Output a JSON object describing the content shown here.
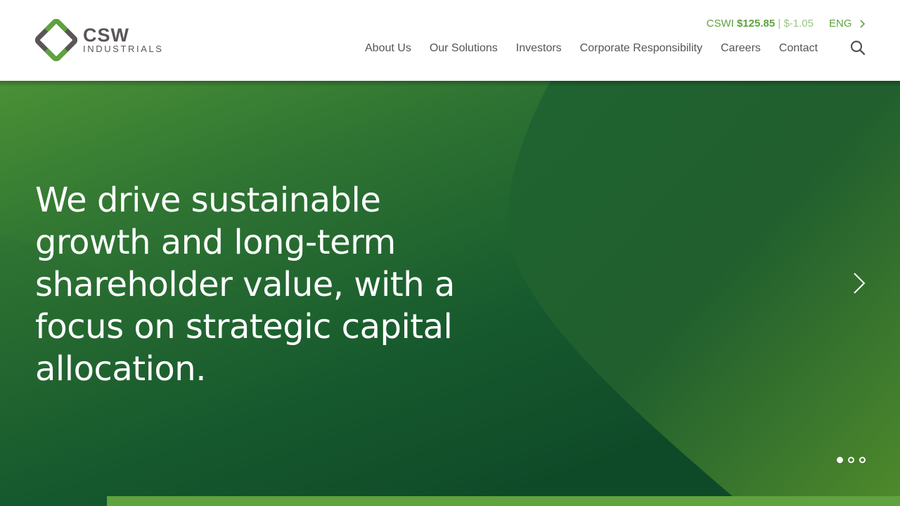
{
  "brand": {
    "name_line1": "CSW",
    "name_line2": "INDUSTRIALS",
    "colors": {
      "primary_green": "#5fa23e",
      "dark_gray": "#5b5555",
      "text_gray": "#555555"
    }
  },
  "header": {
    "ticker": {
      "symbol": "CSWI",
      "price": "$125.85",
      "separator": "|",
      "change": "$-1.05"
    },
    "language": {
      "label": "ENG",
      "icon": "chevron-right-icon"
    },
    "nav": [
      {
        "label": "About Us"
      },
      {
        "label": "Our Solutions"
      },
      {
        "label": "Investors"
      },
      {
        "label": "Corporate Responsibility"
      },
      {
        "label": "Careers"
      },
      {
        "label": "Contact"
      }
    ],
    "search_icon": "search-icon"
  },
  "hero": {
    "headline": "We drive sustainable growth and long-term shareholder value, with a focus on strategic capital allocation.",
    "next_icon": "chevron-right-icon",
    "slides": {
      "count": 3,
      "active": 1
    }
  }
}
